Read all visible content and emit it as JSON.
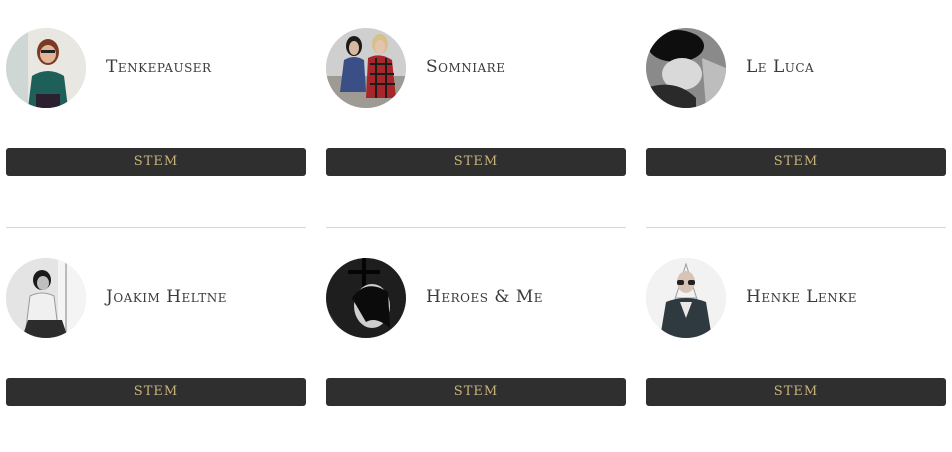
{
  "colors": {
    "button_bg": "#2f2f2f",
    "button_text": "#c9b27a",
    "name_text": "#3a3a3a",
    "divider": "#d6d6d6"
  },
  "artists": [
    {
      "name": "Tenkepauser",
      "button_label": "STEM",
      "avatar_icon": "artist-photo-woman-teal-shirt"
    },
    {
      "name": "Somniare",
      "button_label": "STEM",
      "avatar_icon": "artist-photo-two-women-plaid"
    },
    {
      "name": "Le Luca",
      "button_label": "STEM",
      "avatar_icon": "artist-photo-bw-man"
    },
    {
      "name": "Joakim Heltne",
      "button_label": "STEM",
      "avatar_icon": "artist-photo-bw-sitting-man"
    },
    {
      "name": "Heroes & Me",
      "button_label": "STEM",
      "avatar_icon": "artist-photo-bw-cross"
    },
    {
      "name": "Henke Lenke",
      "button_label": "STEM",
      "avatar_icon": "artist-photo-man-sunglasses"
    }
  ]
}
